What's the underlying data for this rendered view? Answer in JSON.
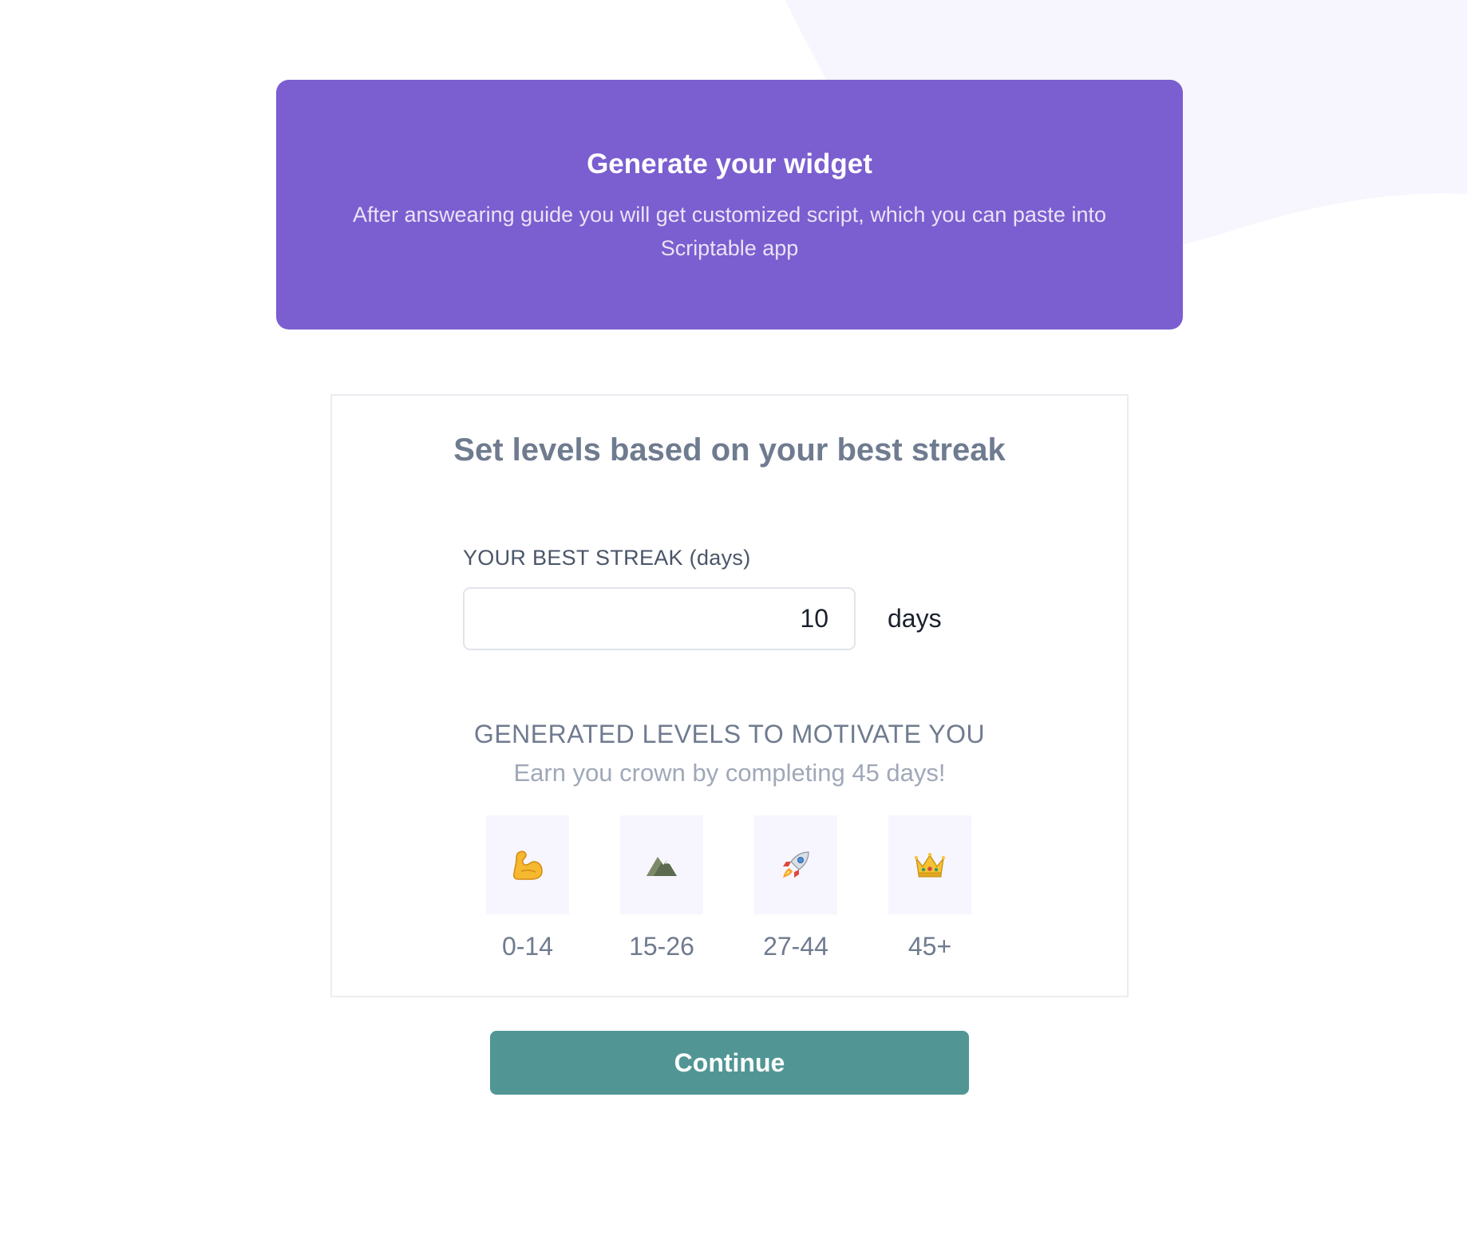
{
  "colors": {
    "hero_bg": "#7b5ecf",
    "accent_button": "#519694",
    "background_blob": "#f7f5fd",
    "level_tile": "#f7f5fd"
  },
  "hero": {
    "title": "Generate your widget",
    "subtitle": "After answearing guide you will get customized script, which you can paste into Scriptable app"
  },
  "card": {
    "title": "Set levels based on your best streak",
    "streak_field": {
      "label": "YOUR BEST STREAK (days)",
      "value": "10",
      "unit": "days"
    },
    "levels": {
      "heading": "GENERATED LEVELS TO MOTIVATE YOU",
      "subheading": "Earn you crown by completing 45 days!",
      "items": [
        {
          "icon": "flexed-biceps-icon",
          "range": "0-14"
        },
        {
          "icon": "mountain-icon",
          "range": "15-26"
        },
        {
          "icon": "rocket-icon",
          "range": "27-44"
        },
        {
          "icon": "crown-icon",
          "range": "45+"
        }
      ]
    }
  },
  "actions": {
    "continue_label": "Continue"
  }
}
